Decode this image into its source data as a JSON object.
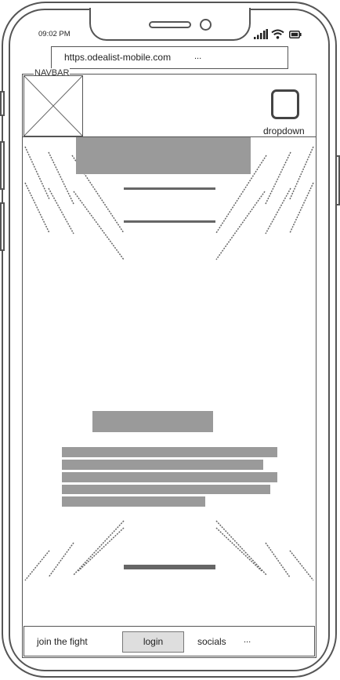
{
  "status_bar": {
    "time": "09:02 PM"
  },
  "browser": {
    "url": "https.odealist-mobile.com",
    "more": "..."
  },
  "navbar": {
    "label": "NAVBAR",
    "dropdown_label": "dropdown"
  },
  "footer": {
    "join_label": "join the fight",
    "login_label": "login",
    "socials_label": "socials",
    "more": "..."
  },
  "icons": {
    "signal": "signal-icon",
    "wifi": "wifi-icon",
    "battery": "battery-icon",
    "image_placeholder": "image-placeholder-icon",
    "dropdown": "dropdown-icon"
  }
}
